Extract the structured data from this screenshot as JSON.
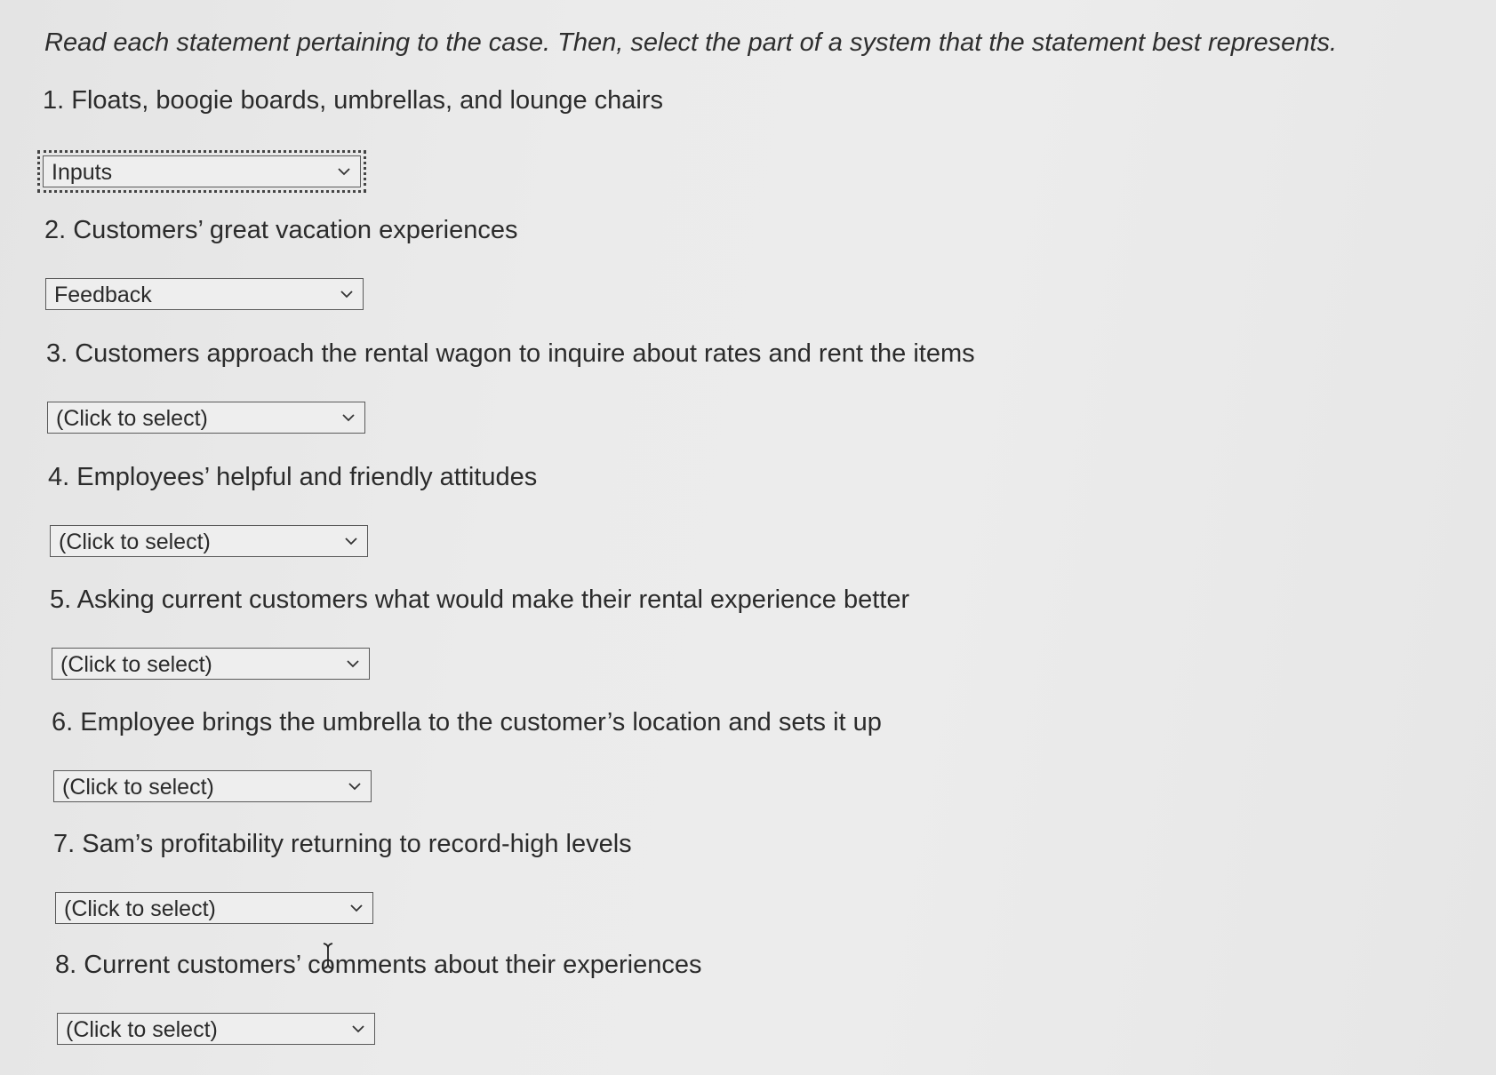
{
  "instructions": "Read each statement pertaining to the case. Then, select the part of a system that the statement best represents.",
  "items": [
    {
      "question": "1. Floats, boogie boards, umbrellas, and lounge chairs",
      "selected": "Inputs"
    },
    {
      "question": "2. Customers’ great vacation experiences",
      "selected": "Feedback"
    },
    {
      "question": "3. Customers approach the rental wagon to inquire about rates and rent the items",
      "selected": "(Click to select)"
    },
    {
      "question": "4. Employees’ helpful and friendly attitudes",
      "selected": "(Click to select)"
    },
    {
      "question": "5. Asking current customers what would make their rental experience better",
      "selected": "(Click to select)"
    },
    {
      "question": "6. Employee brings the umbrella to the customer’s location and sets it up",
      "selected": "(Click to select)"
    },
    {
      "question": "7. Sam’s profitability returning to record-high levels",
      "selected": "(Click to select)"
    },
    {
      "question": "8. Current customers’ comments about their experiences",
      "selected": "(Click to select)"
    }
  ],
  "icons": {
    "dropdown": "chevron-down-icon",
    "cursor": "text-cursor-icon"
  }
}
